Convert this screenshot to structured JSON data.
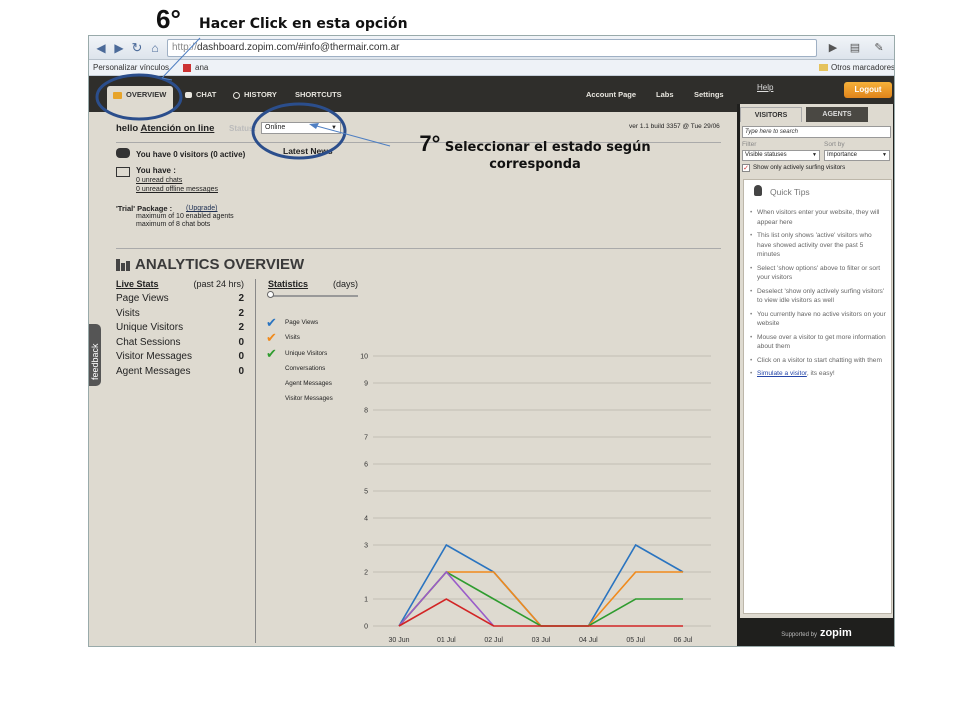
{
  "annotations": {
    "step6_num": "6°",
    "step6_text": "Hacer Click en esta opción",
    "step7_num": "7°",
    "step7_text_line1": "Seleccionar el estado según",
    "step7_text_line2": "corresponda"
  },
  "browser": {
    "url_scheme": "http://",
    "url_rest": "dashboard.zopim.com/#info@thermair.com.ar",
    "bookmarks": [
      "Personalizar vínculos",
      "ana"
    ],
    "other_bookmarks": "Otros marcadores"
  },
  "nav": {
    "tabs": [
      "OVERVIEW",
      "CHAT",
      "HISTORY",
      "SHORTCUTS"
    ],
    "links": [
      "Account Page",
      "Labs",
      "Settings"
    ],
    "help": "Help",
    "logout": "Logout"
  },
  "header": {
    "hello": "hello",
    "user": "Atención on line",
    "status_label": "Status:",
    "status_value": "Online",
    "version": "ver 1.1 build 3357 @ Tue 29/06",
    "latest_news": "Latest News"
  },
  "summary": {
    "visitors": "You have 0 visitors (0 active)",
    "you_have": "You have :",
    "unread_chats": "0 unread chats",
    "unread_offline": "0 unread offline messages",
    "package": "'Trial' Package :",
    "upgrade": "(Upgrade)",
    "max_agents": "maximum of 10 enabled agents",
    "max_bots": "maximum of 8 chat bots"
  },
  "feedback": "feedback",
  "analytics": {
    "title": "ANALYTICS OVERVIEW",
    "live_stats": "Live Stats",
    "past": "(past 24 hrs)",
    "stats": [
      {
        "label": "Page Views",
        "value": "2"
      },
      {
        "label": "Visits",
        "value": "2"
      },
      {
        "label": "Unique Visitors",
        "value": "2"
      },
      {
        "label": "Chat Sessions",
        "value": "0"
      },
      {
        "label": "Visitor Messages",
        "value": "0"
      },
      {
        "label": "Agent Messages",
        "value": "0"
      }
    ],
    "statistics": "Statistics",
    "days": "(days)",
    "legend": [
      {
        "label": "Page Views",
        "checked": true,
        "color": "#2a74c0"
      },
      {
        "label": "Visits",
        "checked": true,
        "color": "#f08a1c"
      },
      {
        "label": "Unique Visitors",
        "checked": true,
        "color": "#2f9c2f"
      },
      {
        "label": "Conversations",
        "checked": false
      },
      {
        "label": "Agent Messages",
        "checked": false
      },
      {
        "label": "Visitor Messages",
        "checked": false
      }
    ]
  },
  "chart_data": {
    "type": "line",
    "categories": [
      "30 Jun",
      "01 Jul",
      "02 Jul",
      "03 Jul",
      "04 Jul",
      "05 Jul",
      "06 Jul"
    ],
    "ylim": [
      0,
      10
    ],
    "yticks": [
      "0",
      "1",
      "2",
      "3",
      "4",
      "5",
      "6",
      "7",
      "8",
      "9",
      "10"
    ],
    "series": [
      {
        "name": "Page Views",
        "color": "#2a74c0",
        "x": [
          0,
          1,
          2,
          3,
          4,
          5,
          6
        ],
        "values": [
          0,
          3,
          2,
          0,
          0,
          3,
          2
        ]
      },
      {
        "name": "Visits",
        "color": "#f08a1c",
        "x": [
          0,
          1,
          2,
          3,
          4,
          5,
          6
        ],
        "values": [
          0,
          2,
          2,
          0,
          0,
          2,
          2
        ]
      },
      {
        "name": "Unique Visitors",
        "color": "#2f9c2f",
        "x": [
          0,
          1,
          2,
          3,
          4,
          5,
          6
        ],
        "values": [
          0,
          2,
          1,
          0,
          0,
          1,
          1
        ]
      },
      {
        "color": "#9a5cc9",
        "x": [
          0,
          1,
          2
        ],
        "values": [
          0,
          2,
          0
        ]
      },
      {
        "color": "#d22525",
        "x": [
          0,
          1,
          2,
          3,
          4,
          5,
          6
        ],
        "values": [
          0,
          1,
          0,
          0,
          0,
          0,
          0
        ]
      }
    ]
  },
  "sidebar": {
    "tabs": [
      "VISITORS",
      "AGENTS"
    ],
    "search_placeholder": "Type here to search",
    "filter_label": "Filter",
    "filter_value": "Visible statuses",
    "sortby_label": "Sort by",
    "sortby_value": "Importance",
    "show_active": "Show only actively surfing visitors",
    "quick_tips": "Quick Tips",
    "tips": [
      "When visitors enter your website, they will appear here",
      "This list only shows 'active' visitors who have showed activity over the past 5 minutes",
      "Select 'show options' above to filter or sort your visitors",
      "Deselect 'show only actively surfing visitors' to view idle visitors as well",
      "You currently have no active visitors on your website",
      "Mouse over a visitor to get more information about them",
      "Click on a visitor to start chatting with them"
    ],
    "simulate_link": "Simulate a visitor",
    "simulate_rest": ", its easy!",
    "supported_by": "Supported by",
    "brand": "zopim"
  }
}
